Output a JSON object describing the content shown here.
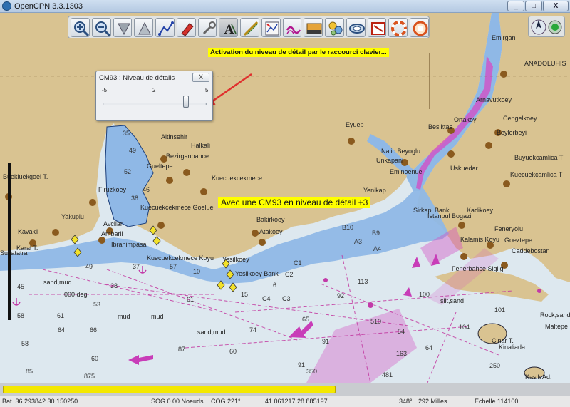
{
  "window": {
    "title": "OpenCPN 3.3.1303",
    "minimize_glyph": "_",
    "maximize_glyph": "□",
    "close_glyph": "X"
  },
  "toolbar": {
    "buttons": [
      {
        "name": "zoom-in-icon"
      },
      {
        "name": "zoom-out-icon"
      },
      {
        "name": "chart-scale-down-icon"
      },
      {
        "name": "chart-scale-up-icon"
      },
      {
        "name": "route-icon"
      },
      {
        "name": "follow-ship-icon"
      },
      {
        "name": "settings-icon"
      },
      {
        "name": "text-icon",
        "active": true
      },
      {
        "name": "measure-icon"
      },
      {
        "name": "current-icon"
      },
      {
        "name": "tide-icon"
      },
      {
        "name": "print-icon"
      },
      {
        "name": "route-manager-icon"
      },
      {
        "name": "track-icon"
      },
      {
        "name": "colour-scheme-icon"
      },
      {
        "name": "mob-icon"
      },
      {
        "name": "help-icon"
      }
    ]
  },
  "compass": {
    "needle": "north-arrow-icon",
    "gps": "gps-status-icon"
  },
  "annotations": {
    "top": "Activation du niveau de détail par le raccourci clavier...",
    "middle": "Avec une CM93 en niveau de détail +3"
  },
  "cm93_dialog": {
    "title": "CM93 : Niveau de détails",
    "close_glyph": "X",
    "min_label": "-5",
    "mid_label": "2",
    "max_label": "5",
    "slider": {
      "min": -5,
      "max": 5,
      "value": 3
    }
  },
  "map_labels": [
    {
      "text": "Emirgan"
    },
    {
      "text": "ANADOLUHIS"
    },
    {
      "text": "Arnavutkoey"
    },
    {
      "text": "Ortakoy"
    },
    {
      "text": "Cengelkoey"
    },
    {
      "text": "Besiktas"
    },
    {
      "text": "Beylerbeyi"
    },
    {
      "text": "Eyuep"
    },
    {
      "text": "Buyuekcamlica T"
    },
    {
      "text": "Altinsehir"
    },
    {
      "text": "Halkali"
    },
    {
      "text": "Bezirganbahce"
    },
    {
      "text": "Gueltepe"
    },
    {
      "text": "Kuecuekcekmece"
    },
    {
      "text": "Nalic Beyoglu"
    },
    {
      "text": "Unkapani"
    },
    {
      "text": "Eminoenue"
    },
    {
      "text": "Uskuedar"
    },
    {
      "text": "Kuecuekcamlica T"
    },
    {
      "text": "Yenikap"
    },
    {
      "text": "Firuzkoey"
    },
    {
      "text": "Buekluekgoel T."
    },
    {
      "text": "Kuecuekcekmece Goeluе"
    },
    {
      "text": "Yakuplu"
    },
    {
      "text": "Bakirkoey"
    },
    {
      "text": "Atakoey"
    },
    {
      "text": "Kavakli"
    },
    {
      "text": "Avcilar"
    },
    {
      "text": "Ambarli"
    },
    {
      "text": "Kadikoey"
    },
    {
      "text": "Istanbul Bogazi"
    },
    {
      "text": "Sirkapi Bank"
    },
    {
      "text": "Feneryolu"
    },
    {
      "text": "Kalamis Koyu"
    },
    {
      "text": "Goeztepe"
    },
    {
      "text": "Caddebostan"
    },
    {
      "text": "Kuecuekcekmece Koyu"
    },
    {
      "text": "Yesilkoey"
    },
    {
      "text": "Yesilkoey Bank"
    },
    {
      "text": "Fenerbahce Sigligi"
    },
    {
      "text": "Ibrahimpasa"
    },
    {
      "text": "Karal T."
    },
    {
      "text": "Sutlatatra"
    },
    {
      "text": "sand,mud"
    },
    {
      "text": "000 deg"
    },
    {
      "text": "silt,sand"
    },
    {
      "text": "mud"
    },
    {
      "text": "mud"
    },
    {
      "text": "sand,mud"
    },
    {
      "text": "Maltepe"
    },
    {
      "text": "Rock,sand"
    },
    {
      "text": "Cinar T."
    },
    {
      "text": "Kinaliada"
    },
    {
      "text": "Kasik Ad."
    }
  ],
  "depth_soundings": [
    "49",
    "37",
    "38",
    "57",
    "45",
    "58",
    "61",
    "53",
    "64",
    "66",
    "61",
    "58",
    "60",
    "85",
    "74",
    "87",
    "91",
    "60",
    "875",
    "481",
    "350",
    "510",
    "54",
    "64",
    "104",
    "250",
    "101",
    "163",
    "92",
    "113",
    "100",
    "65",
    "91",
    "C1",
    "C2",
    "C4",
    "C3",
    "B10",
    "B9",
    "A3",
    "A4",
    "35",
    "49",
    "52",
    "46",
    "38",
    "10",
    "15",
    "6"
  ],
  "status": {
    "progress": 0.59,
    "bat": "Bat. 36.293842   30.150250",
    "sog": "SOG 0.00 Noeuds",
    "cog": "COG 221°",
    "position": "41.061217   28.885197",
    "bearing": "348°",
    "distance": "292 Milles",
    "scale": "Echelle 114100"
  },
  "colors": {
    "land": "#d9c391",
    "shallow_water": "#8fb8e6",
    "deep_water": "#dde8ef",
    "magenta": "#d54ac4",
    "annotation": "#ffff00",
    "arrow": "#e0302e"
  }
}
